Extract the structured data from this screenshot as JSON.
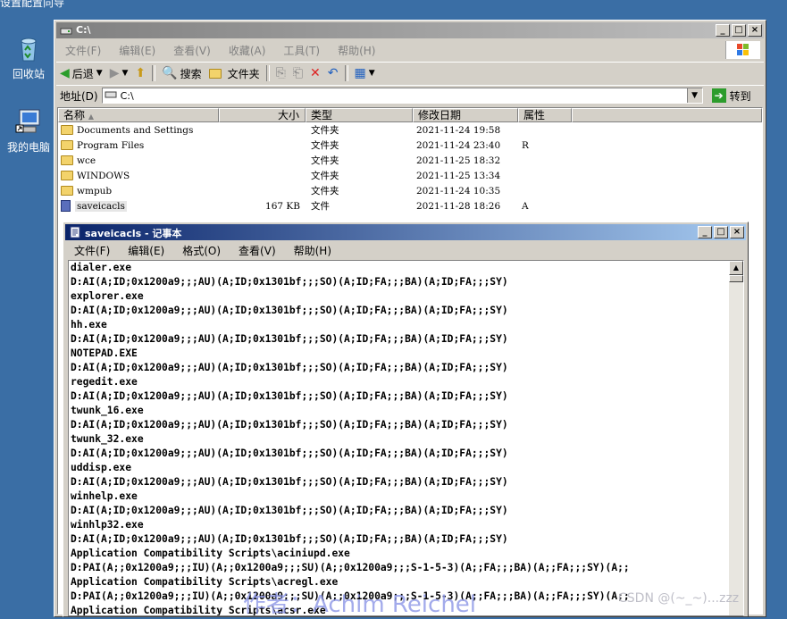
{
  "desktop": {
    "top_text": "设置配置向导",
    "icons": [
      {
        "label": "回收站"
      },
      {
        "label": "我的电脑"
      }
    ]
  },
  "explorer": {
    "title": "C:\\",
    "menu": [
      "文件(F)",
      "编辑(E)",
      "查看(V)",
      "收藏(A)",
      "工具(T)",
      "帮助(H)"
    ],
    "toolbar": {
      "back": "后退",
      "search": "搜索",
      "folders": "文件夹"
    },
    "address": {
      "label": "地址(D)",
      "value": "C:\\",
      "go": "转到"
    },
    "columns": [
      "名称",
      "大小",
      "类型",
      "修改日期",
      "属性"
    ],
    "rows": [
      {
        "name": "Documents and Settings",
        "size": "",
        "type": "文件夹",
        "date": "2021-11-24 19:58",
        "attr": ""
      },
      {
        "name": "Program Files",
        "size": "",
        "type": "文件夹",
        "date": "2021-11-24 23:40",
        "attr": "R"
      },
      {
        "name": "wce",
        "size": "",
        "type": "文件夹",
        "date": "2021-11-25 18:32",
        "attr": ""
      },
      {
        "name": "WINDOWS",
        "size": "",
        "type": "文件夹",
        "date": "2021-11-25 13:34",
        "attr": ""
      },
      {
        "name": "wmpub",
        "size": "",
        "type": "文件夹",
        "date": "2021-11-24 10:35",
        "attr": ""
      },
      {
        "name": "saveicacls",
        "size": "167 KB",
        "type": "文件",
        "date": "2021-11-28 18:26",
        "attr": "A"
      }
    ]
  },
  "notepad": {
    "title": "saveicacls - 记事本",
    "menu": [
      "文件(F)",
      "编辑(E)",
      "格式(O)",
      "查看(V)",
      "帮助(H)"
    ],
    "lines": [
      "dialer.exe",
      "D:AI(A;ID;0x1200a9;;;AU)(A;ID;0x1301bf;;;SO)(A;ID;FA;;;BA)(A;ID;FA;;;SY)",
      "explorer.exe",
      "D:AI(A;ID;0x1200a9;;;AU)(A;ID;0x1301bf;;;SO)(A;ID;FA;;;BA)(A;ID;FA;;;SY)",
      "hh.exe",
      "D:AI(A;ID;0x1200a9;;;AU)(A;ID;0x1301bf;;;SO)(A;ID;FA;;;BA)(A;ID;FA;;;SY)",
      "NOTEPAD.EXE",
      "D:AI(A;ID;0x1200a9;;;AU)(A;ID;0x1301bf;;;SO)(A;ID;FA;;;BA)(A;ID;FA;;;SY)",
      "regedit.exe",
      "D:AI(A;ID;0x1200a9;;;AU)(A;ID;0x1301bf;;;SO)(A;ID;FA;;;BA)(A;ID;FA;;;SY)",
      "twunk_16.exe",
      "D:AI(A;ID;0x1200a9;;;AU)(A;ID;0x1301bf;;;SO)(A;ID;FA;;;BA)(A;ID;FA;;;SY)",
      "twunk_32.exe",
      "D:AI(A;ID;0x1200a9;;;AU)(A;ID;0x1301bf;;;SO)(A;ID;FA;;;BA)(A;ID;FA;;;SY)",
      "uddisp.exe",
      "D:AI(A;ID;0x1200a9;;;AU)(A;ID;0x1301bf;;;SO)(A;ID;FA;;;BA)(A;ID;FA;;;SY)",
      "winhelp.exe",
      "D:AI(A;ID;0x1200a9;;;AU)(A;ID;0x1301bf;;;SO)(A;ID;FA;;;BA)(A;ID;FA;;;SY)",
      "winhlp32.exe",
      "D:AI(A;ID;0x1200a9;;;AU)(A;ID;0x1301bf;;;SO)(A;ID;FA;;;BA)(A;ID;FA;;;SY)",
      "Application Compatibility Scripts\\aciniupd.exe",
      "D:PAI(A;;0x1200a9;;;IU)(A;;0x1200a9;;;SU)(A;;0x1200a9;;;S-1-5-3)(A;;FA;;;BA)(A;;FA;;;SY)(A;;",
      "Application Compatibility Scripts\\acregl.exe",
      "D:PAI(A;;0x1200a9;;;IU)(A;;0x1200a9;;;SU)(A;;0x1200a9;;;S-1-5-3)(A;;FA;;;BA)(A;;FA;;;SY)(A;;",
      "Application Compatibility Scripts\\acsr.exe"
    ]
  },
  "watermarks": {
    "author": "作者：Achim Reichel",
    "csdn": "CSDN @(~_~)...zzz"
  }
}
